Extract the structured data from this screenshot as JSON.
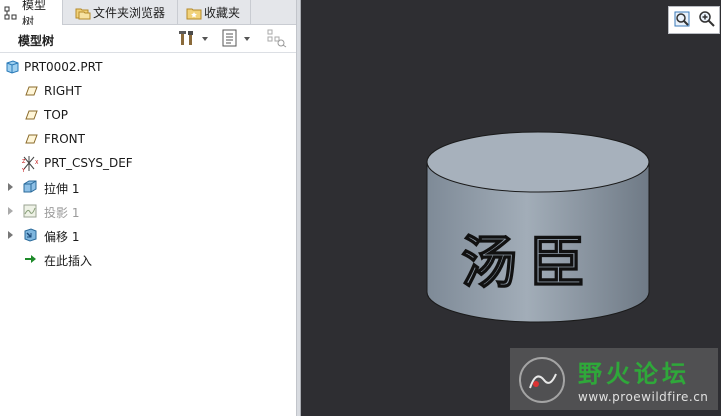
{
  "tabs": [
    {
      "label": "模型树",
      "icon": "tree-icon",
      "active": true
    },
    {
      "label": "文件夹浏览器",
      "icon": "folder-browser-icon",
      "active": false
    },
    {
      "label": "收藏夹",
      "icon": "favorites-icon",
      "active": false
    }
  ],
  "toolbar": {
    "title": "模型树"
  },
  "tree": {
    "root": "PRT0002.PRT",
    "items": [
      {
        "label": "RIGHT",
        "icon": "datum-plane-icon"
      },
      {
        "label": "TOP",
        "icon": "datum-plane-icon"
      },
      {
        "label": "FRONT",
        "icon": "datum-plane-icon"
      },
      {
        "label": "PRT_CSYS_DEF",
        "icon": "csys-icon"
      },
      {
        "label": "拉伸 1",
        "icon": "extrude-icon",
        "expandable": true
      },
      {
        "label": "投影 1",
        "icon": "projection-icon",
        "expandable": true,
        "dimmed": true
      },
      {
        "label": "偏移 1",
        "icon": "offset-icon",
        "expandable": true
      },
      {
        "label": "在此插入",
        "icon": "insert-here-arrow-icon"
      }
    ]
  },
  "model": {
    "engraved_text": "汤臣"
  },
  "watermark": {
    "title": "野火论坛",
    "url": "www.proewildfire.cn"
  },
  "colors": {
    "viewport_bg": "#2e2e32",
    "cylinder_side": "#8a96a3",
    "cylinder_top": "#a9b3be",
    "watermark_green": "#2fa83a"
  }
}
